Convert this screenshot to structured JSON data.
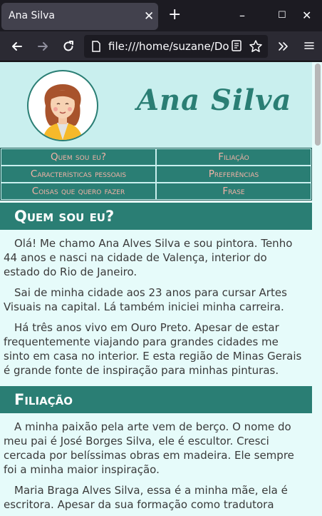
{
  "browser": {
    "tab_title": "Ana Silva",
    "tab_close": "✕",
    "new_tab": "+",
    "url": "file:///home/suzane/Do",
    "window_controls": [
      "–",
      "☐",
      "✕"
    ]
  },
  "icons": {
    "back": "back-arrow-icon",
    "forward": "forward-arrow-icon",
    "reload": "reload-icon",
    "page_info": "page-icon",
    "reader": "reader-view-icon",
    "bookmark": "star-icon",
    "overflow": "chevrons-icon",
    "menu": "hamburger-icon"
  },
  "site": {
    "title": "Ana Silva",
    "menu": [
      "Quem sou eu?",
      "Filiação",
      "Características pessoais",
      "Preferências",
      "Coisas que quero fazer",
      "Frase"
    ]
  },
  "sections": [
    {
      "title": "Quem sou eu?",
      "paragraphs": [
        "Olá! Me chamo Ana Alves Silva e sou pintora. Tenho 44 anos e nasci na cidade de Valença, interior do estado do Rio de Janeiro.",
        "Sai de minha cidade aos 23 anos para cursar Artes Visuais na capital. Lá também iniciei minha carreira.",
        "Há três anos vivo em Ouro Preto. Apesar de estar frequentemente viajando para grandes cidades me sinto em casa no interior. E esta região de Minas Gerais é grande fonte de inspiração para minhas pinturas."
      ]
    },
    {
      "title": "Filiação",
      "paragraphs": [
        "A minha paixão pela arte vem de berço. O nome do meu pai é José Borges Silva, ele é escultor. Cresci cercada por belíssimas obras em madeira. Ele sempre foi a minha maior inspiração.",
        "Maria Braga Alves Silva, essa é a minha mãe, ela é escritora. Apesar da sua formação como tradutora"
      ]
    }
  ],
  "colors": {
    "accent": "#2a7e74",
    "menu_text": "#f2b2a6",
    "header_bg": "#c9efee",
    "page_bg": "#e6fbfa"
  }
}
